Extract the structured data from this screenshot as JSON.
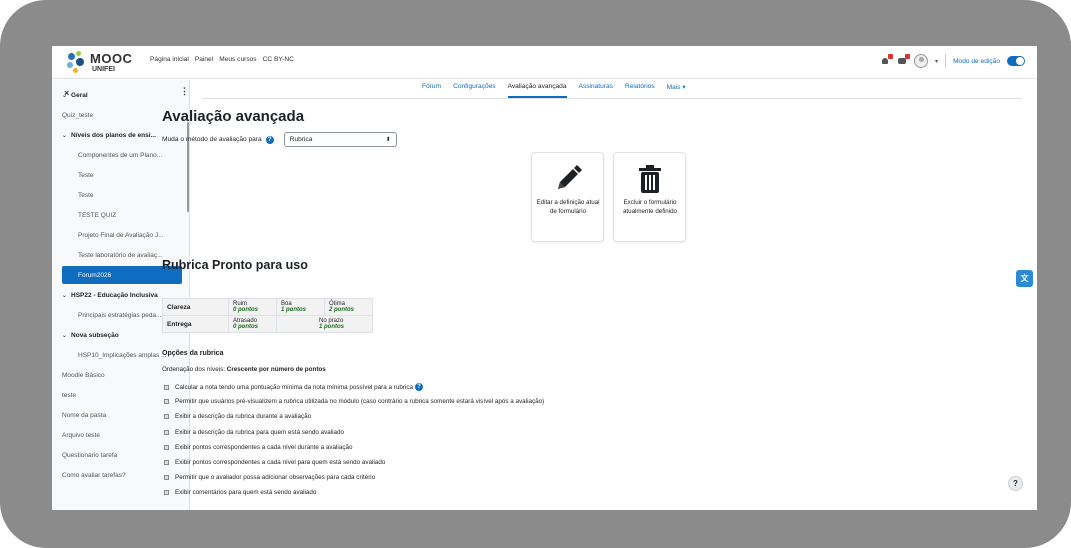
{
  "brand": {
    "logo_text": "MOOC",
    "logo_sub": "UNIFEI"
  },
  "navbar": {
    "links": [
      "Página inicial",
      "Painel",
      "Meus cursos",
      "CC BY-NC"
    ],
    "edit_mode_label": "Modo de edição"
  },
  "drawer": {
    "close_label": "×",
    "menu_label": "⋮",
    "items": [
      {
        "label": "Geral",
        "type": "section",
        "expanded": true
      },
      {
        "label": "Quiz_teste",
        "type": "item"
      },
      {
        "label": "Níveis dos planos de ensi...",
        "type": "section",
        "expanded": true
      },
      {
        "label": "Componentes de um Plano...",
        "type": "sub"
      },
      {
        "label": "Teste",
        "type": "sub"
      },
      {
        "label": "Teste",
        "type": "sub"
      },
      {
        "label": "TESTE QUIZ",
        "type": "sub"
      },
      {
        "label": "Projeto Final de Avaliação J...",
        "type": "sub"
      },
      {
        "label": "Teste laboratório de avaliaç...",
        "type": "sub"
      },
      {
        "label": "Forum2026",
        "type": "active"
      },
      {
        "label": "HSP22 - Educação Inclusiva",
        "type": "section",
        "expanded": true
      },
      {
        "label": "Principais estratégias peda...",
        "type": "sub"
      },
      {
        "label": "Nova subseção",
        "type": "section",
        "expanded": true
      },
      {
        "label": "HSP10_Implicações amplas ...",
        "type": "sub"
      },
      {
        "label": "Moodle Básico",
        "type": "item"
      },
      {
        "label": "teste",
        "type": "item"
      },
      {
        "label": "Nome da pasta",
        "type": "item"
      },
      {
        "label": "Arquivo teste",
        "type": "item"
      },
      {
        "label": "Questionario tarefa",
        "type": "item"
      },
      {
        "label": "Como avaliar tarefas?",
        "type": "item"
      }
    ]
  },
  "tabs": [
    {
      "label": "Fórum",
      "active": false
    },
    {
      "label": "Configurações",
      "active": false
    },
    {
      "label": "Avaliação avançada",
      "active": true
    },
    {
      "label": "Assinaturas",
      "active": false
    },
    {
      "label": "Relatórios",
      "active": false
    },
    {
      "label": "Mais ▾",
      "active": false
    }
  ],
  "page": {
    "title": "Avaliação avançada",
    "method_label": "Muda o método de avaliação para",
    "method_value": "Rubrica"
  },
  "actions": {
    "edit": "Editar a definição atual de formulário",
    "delete": "Excluir o formulário atualmente definido"
  },
  "rubric": {
    "title": "Rubrica Pronto para uso",
    "criteria": [
      {
        "name": "Clareza",
        "levels": [
          {
            "label": "Ruim",
            "points": "0 pontos"
          },
          {
            "label": "Boa",
            "points": "1 pontos"
          },
          {
            "label": "Ótima",
            "points": "2 pontos"
          }
        ]
      },
      {
        "name": "Entrega",
        "levels": [
          {
            "label": "Atrasado",
            "points": "0 pontos"
          },
          {
            "label": "No prazo",
            "points": "1 pontos"
          }
        ]
      }
    ]
  },
  "options": {
    "title": "Opções da rubrica",
    "sort_label": "Ordenação dos níveis:",
    "sort_value": "Crescente por número de pontos",
    "items": [
      "Calcular a nota tendo uma pontuação mínima da nota mínima possível para a rubrica",
      "Permitir que usuários pré-visualizem a rubrica utilizada no módulo (caso contrário a rubrica somente estará visível após a avaliação)",
      "Exibir a descrição da rubrica durante a avaliação",
      "Exibir a descrição da rubrica para quem está sendo avaliado",
      "Exibir pontos correspondentes a cada nível durante a avaliação",
      "Exibir pontos correspondentes a cada nível para quem está sendo avaliado",
      "Permitir que o avaliador possa adicionar observações para cada critério",
      "Exibir comentários para quem está sendo avaliado"
    ]
  },
  "help_fab": "?",
  "colors": {
    "primary": "#0f6cbf",
    "points_green": "#1e6e1e",
    "frame_gray": "#8b8b8b"
  }
}
